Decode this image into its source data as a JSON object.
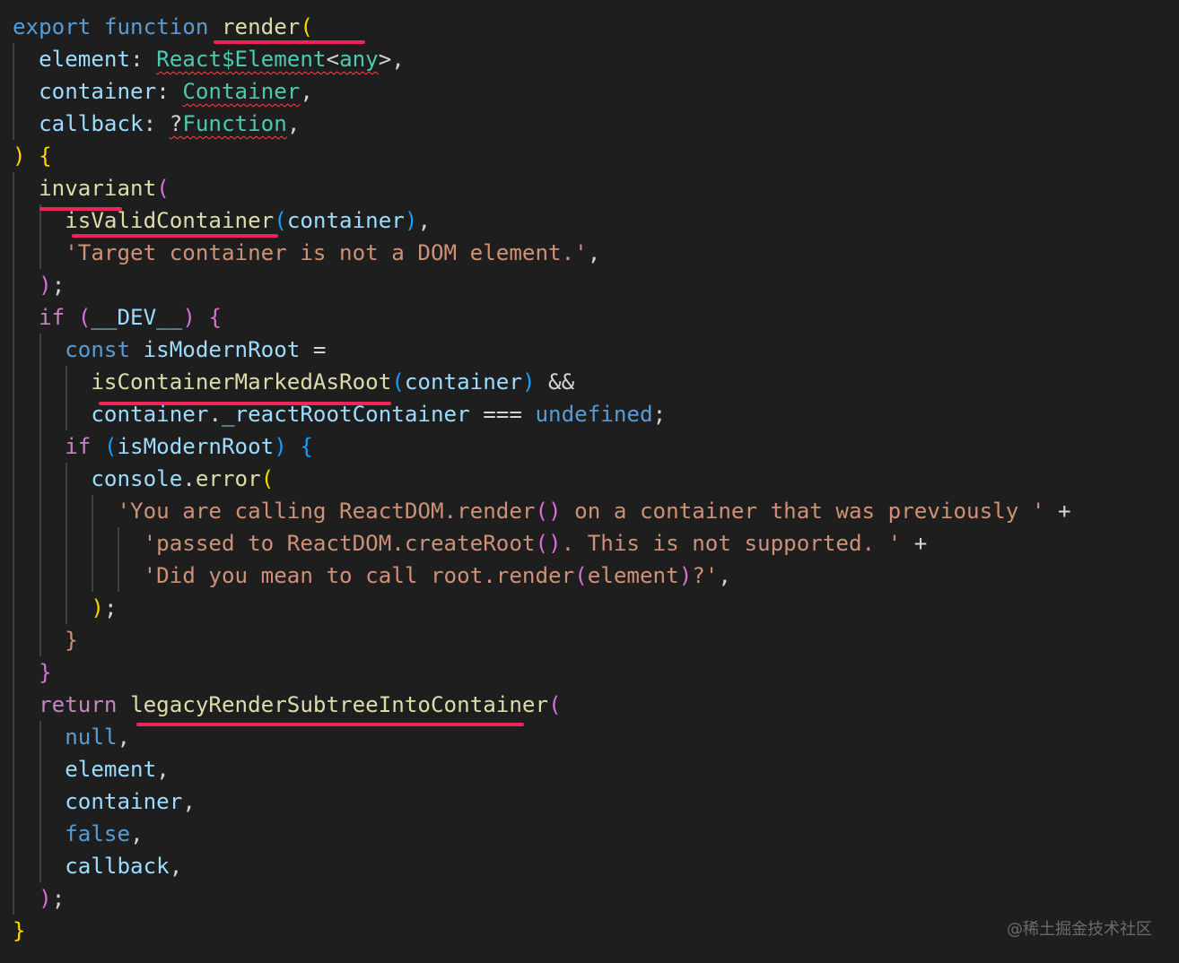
{
  "code_lines": [
    [
      "export",
      " ",
      "function",
      " ",
      "render",
      "("
    ],
    [
      "  ",
      "element",
      ": ",
      "React$Element",
      "<",
      "any",
      ">,"
    ],
    [
      "  ",
      "container",
      ": ",
      "Container",
      ","
    ],
    [
      "  ",
      "callback",
      ": ",
      "?",
      "Function",
      ","
    ],
    [
      ")",
      " ",
      "{"
    ],
    [
      "  ",
      "invariant",
      "("
    ],
    [
      "    ",
      "isValidContainer",
      "(",
      "container",
      ")",
      ","
    ],
    [
      "    ",
      "'Target container is not a DOM element.'",
      ","
    ],
    [
      "  ",
      ")",
      ";"
    ],
    [
      "  ",
      "if",
      " ",
      "(",
      "__DEV__",
      ")",
      " ",
      "{"
    ],
    [
      "    ",
      "const",
      " ",
      "isModernRoot",
      " ="
    ],
    [
      "      ",
      "isContainerMarkedAsRoot",
      "(",
      "container",
      ")",
      " &&"
    ],
    [
      "      ",
      "container",
      ".",
      "_reactRootContainer",
      " === ",
      "undefined",
      ";"
    ],
    [
      "    ",
      "if",
      " ",
      "(",
      "isModernRoot",
      ")",
      " ",
      "{"
    ],
    [
      "      ",
      "console",
      ".",
      "error",
      "("
    ],
    [
      "        ",
      "'You are calling ReactDOM.render",
      "()",
      " on a container that was previously '",
      " +"
    ],
    [
      "          ",
      "'passed to ReactDOM.createRoot",
      "()",
      ". This is not supported. '",
      " +"
    ],
    [
      "          ",
      "'Did you mean to call root.render",
      "(",
      "element",
      ")",
      "?'",
      ","
    ],
    [
      "      ",
      ")",
      ";"
    ],
    [
      "    ",
      "}"
    ],
    [
      "  ",
      "}"
    ],
    [
      "  ",
      "return",
      " ",
      "legacyRenderSubtreeIntoContainer",
      "("
    ],
    [
      "    ",
      "null",
      ","
    ],
    [
      "    ",
      "element",
      ","
    ],
    [
      "    ",
      "container",
      ","
    ],
    [
      "    ",
      "false",
      ","
    ],
    [
      "    ",
      "callback",
      ","
    ],
    [
      "  ",
      ")",
      ";"
    ],
    [
      "}"
    ]
  ],
  "watermark": "@稀土掘金技术社区",
  "colors": {
    "background": "#1e1e1e",
    "keyword": "#569cd6",
    "control": "#c586c0",
    "function": "#dcdcaa",
    "type": "#4ec9b0",
    "variable": "#9cdcfe",
    "string": "#ce9178",
    "bracket_gold": "#ffd700",
    "bracket_pink": "#da70d6",
    "bracket_blue": "#179fff",
    "highlight_underline": "#f0245a",
    "squiggle": "#f44747"
  }
}
